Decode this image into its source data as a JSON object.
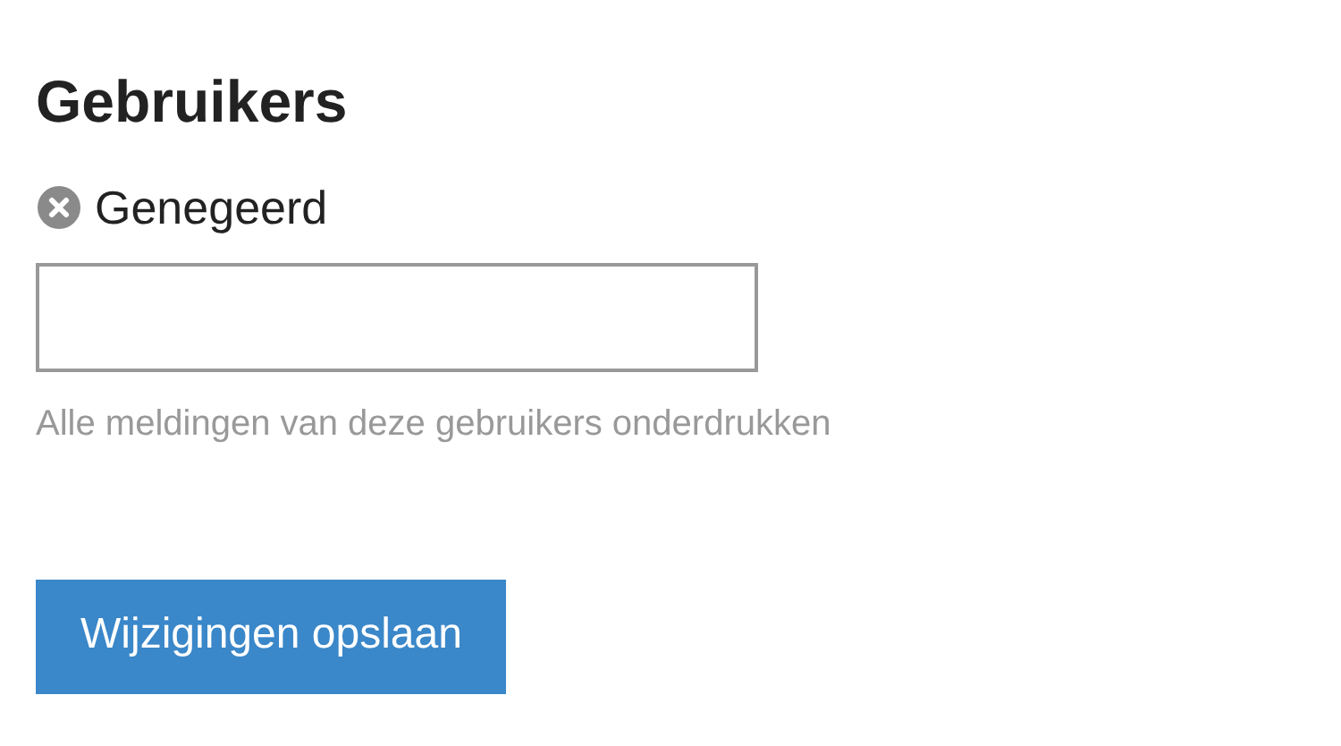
{
  "section": {
    "title": "Gebruikers"
  },
  "field": {
    "label": "Genegeerd",
    "hint": "Alle meldingen van deze gebruikers onderdrukken"
  },
  "buttons": [
    {
      "label": "Wijzigingen opslaan"
    }
  ]
}
